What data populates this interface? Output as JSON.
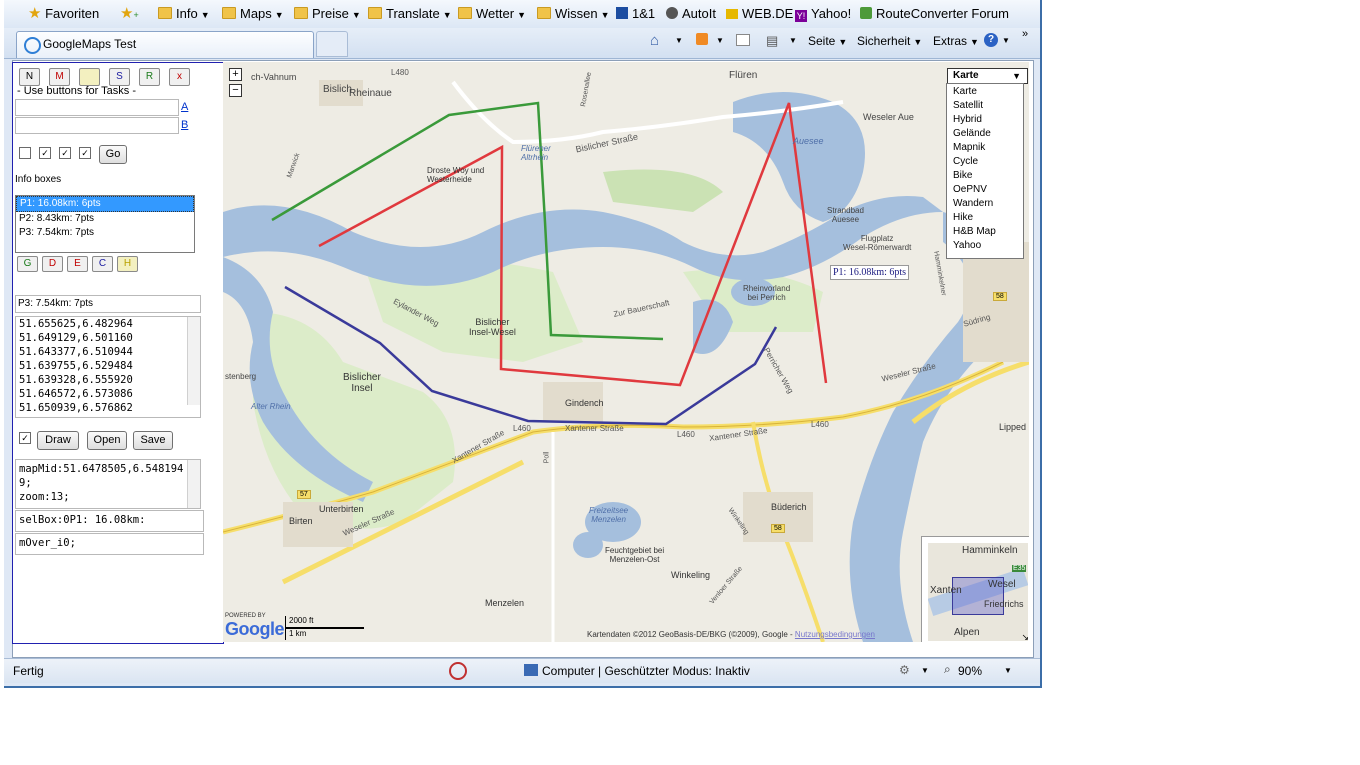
{
  "favbar": {
    "favorites_label": "Favoriten",
    "items": [
      {
        "label": "Info"
      },
      {
        "label": "Maps"
      },
      {
        "label": "Preise"
      },
      {
        "label": "Translate"
      },
      {
        "label": "Wetter"
      },
      {
        "label": "Wissen"
      },
      {
        "label": "1&1"
      },
      {
        "label": "AutoIt"
      },
      {
        "label": "WEB.DE"
      },
      {
        "label": "Yahoo!"
      },
      {
        "label": "RouteConverter Forum"
      }
    ]
  },
  "tabs": {
    "active_title": "GoogleMaps Test"
  },
  "commandbar": {
    "seite": "Seite",
    "sicherheit": "Sicherheit",
    "extras": "Extras"
  },
  "panel": {
    "buttons": [
      "N",
      "M",
      "",
      "S",
      "R",
      "x"
    ],
    "tasks_hint": "- Use buttons for Tasks -",
    "link_a": "A",
    "link_b": "B",
    "go_label": "Go",
    "infoboxes_label": "Info boxes",
    "list_items": [
      "P1: 16.08km: 6pts",
      "P2: 8.43km: 7pts",
      "P3: 7.54km: 7pts"
    ],
    "color_buttons": [
      "G",
      "D",
      "E",
      "C",
      "H"
    ],
    "selected_field": "P3: 7.54km: 7pts",
    "coords": [
      "51.655625,6.482964",
      "51.649129,6.501160",
      "51.643377,6.510944",
      "51.639755,6.529484",
      "51.639328,6.555920",
      "51.646572,6.573086",
      "51.650939,6.576862"
    ],
    "draw_label": "Draw",
    "open_label": "Open",
    "save_label": "Save",
    "mapmid_text": "mapMid:51.6478505,6.5481949;",
    "zoom_text": "zoom:13;",
    "selbox_text": "selBox:0P1: 16.08km:",
    "mover_text": "mOver_i0;"
  },
  "map": {
    "maptype_selected": "Karte",
    "maptype_options": [
      "Karte",
      "Satellit",
      "Hybrid",
      "Gelände",
      "Mapnik",
      "Cycle",
      "Bike",
      "OePNV",
      "Wandern",
      "Hike",
      "H&B Map",
      "Yahoo"
    ],
    "tooltip": "P1: 16.08km: 6pts",
    "labels": {
      "rheinaue": "Rheinaue",
      "vahnum": "ch-Vahnum",
      "bislich": "Bislich",
      "flueren": "Flüren",
      "weseler_aue": "Weseler Aue",
      "droste_1": "Droste Woy und",
      "droste_2": "Westerheide",
      "fluerener_1": "Flürener",
      "fluerener_2": "Altrhein",
      "bislicher_str": "Bislicher Straße",
      "auesee": "Auesee",
      "strandbad_1": "Strandbad",
      "strandbad_2": "Auesee",
      "flugplatz_1": "Flugplatz",
      "flugplatz_2": "Wesel-Römerwardt",
      "rheinvorland_1": "Rheinvorland",
      "rheinvorland_2": "bei Perrich",
      "zur_bauerschaft": "Zur Bauerschaft",
      "eylander_weg": "Eylander Weg",
      "bislicher_insel_wesel_1": "Bislicher",
      "bislicher_insel_wesel_2": "Insel-Wesel",
      "bislicher_insel_1": "Bislicher",
      "bislicher_insel_2": "Insel",
      "stenberg": "stenberg",
      "alter_rhein": "Alter Rhein",
      "gindench": "Gindench",
      "l460": "L460",
      "l480": "L480",
      "xantener_str": "Xantener Straße",
      "weseler_str": "Weseler Straße",
      "unterbirten": "Unterbirten",
      "birten": "Birten",
      "menzelen": "Menzelen",
      "winkeling": "Winkeling",
      "budenich": "Büderich",
      "freizeitsee_1": "Freizeitsee",
      "freizeitsee_2": "Menzelen",
      "feuchtgebiet_1": "Feuchtgebiet bei",
      "feuchtgebiet_2": "Menzelen-Ost",
      "lippedorf": "Lipped",
      "hamminkeln": "Hamminkeln",
      "wesel": "Wesel",
      "xanten": "Xanten",
      "friedrichs": "Friedrichs",
      "alpen": "Alpen",
      "e35": "E35",
      "suedring": "Südring",
      "perricher_weg": "Perricher Weg",
      "warwick": "Marwick",
      "pergmann": "Rosenallee",
      "hammelring": "Hamminkelner",
      "poll": "Poll",
      "winkeling_str": "Winkeling",
      "venlo": "Venloer Straße",
      "road_57": "57",
      "road_58": "58"
    },
    "scale_ft": "2000 ft",
    "scale_km": "1 km",
    "powered_by": "POWERED BY",
    "google": "Google",
    "attribution": "Kartendaten ©2012 GeoBasis-DE/BKG (©2009), Google -",
    "terms_link": "Nutzungsbedingungen",
    "zoom_in": "+",
    "zoom_out": "−"
  },
  "statusbar": {
    "status": "Fertig",
    "zone": "Computer | Geschützter Modus: Inaktiv",
    "zoom": "90%"
  },
  "colors": {
    "route_red": "#e0393e",
    "route_green": "#3a9a3a",
    "route_blue": "#3a3a9a",
    "water": "#a5bfdd",
    "road_yellow": "#f6de6a",
    "forest": "#cbe2b4"
  }
}
